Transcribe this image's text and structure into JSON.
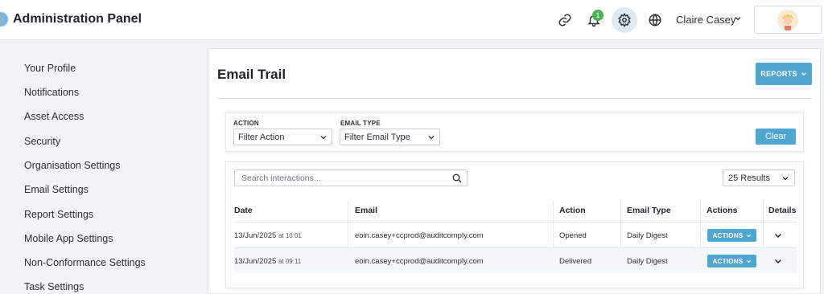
{
  "app": {
    "title": "Administration Panel"
  },
  "header": {
    "user_name": "Claire Casey",
    "notification_count": "1",
    "icons": [
      "link-icon",
      "bell-icon",
      "gear-icon",
      "globe-icon",
      "chevron-down-icon",
      "avatar"
    ]
  },
  "sidebar": {
    "items": [
      {
        "label": "Your Profile"
      },
      {
        "label": "Notifications"
      },
      {
        "label": "Asset Access"
      },
      {
        "label": "Security"
      },
      {
        "label": "Organisation Settings"
      },
      {
        "label": "Email Settings"
      },
      {
        "label": "Report Settings"
      },
      {
        "label": "Mobile App Settings"
      },
      {
        "label": "Non-Conformance Settings"
      },
      {
        "label": "Task Settings"
      }
    ]
  },
  "main": {
    "title": "Email Trail",
    "reports_label": "REPORTS",
    "filters": {
      "action_label": "ACTION",
      "action_value": "Filter Action",
      "email_type_label": "EMAIL TYPE",
      "email_type_value": "Filter Email Type",
      "clear_label": "Clear"
    },
    "search": {
      "placeholder": "Search interactions..."
    },
    "results_label": "25 Results",
    "table": {
      "columns": [
        "Date",
        "Email",
        "Action",
        "Email Type",
        "Actions",
        "Details"
      ],
      "rows": [
        {
          "date": "13/Jun/2025",
          "time": "at 10:01",
          "email": "eoin.casey+ccprod@auditcomply.com",
          "action": "Opened",
          "email_type": "Daily Digest",
          "actions_label": "ACTIONS"
        },
        {
          "date": "13/Jun/2025",
          "time": "at 09:11",
          "email": "eoin.casey+ccprod@auditcomply.com",
          "action": "Delivered",
          "email_type": "Daily Digest",
          "actions_label": "ACTIONS"
        }
      ]
    }
  },
  "colors": {
    "accent": "#4fa6d1",
    "badge": "#4caf50",
    "background": "#f2f3f5"
  }
}
